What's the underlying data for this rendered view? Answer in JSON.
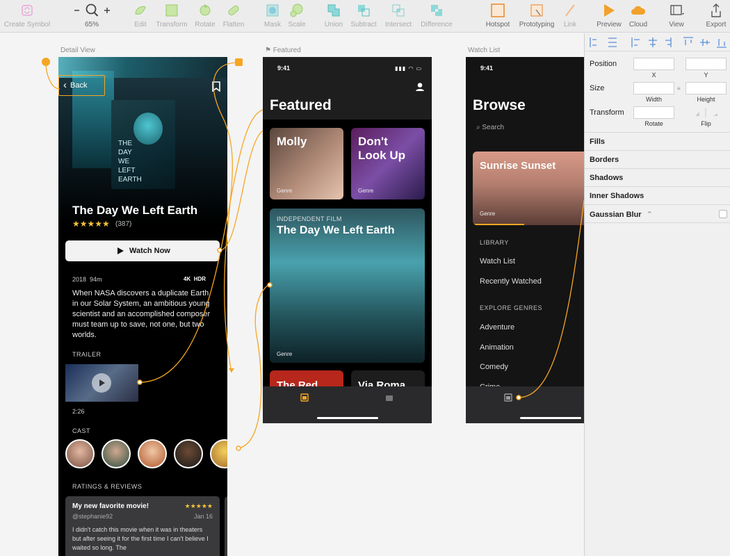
{
  "toolbar": {
    "create_symbol": "Create Symbol",
    "zoom": "65%",
    "edit": "Edit",
    "transform": "Transform",
    "rotate": "Rotate",
    "flatten": "Flatten",
    "mask": "Mask",
    "scale": "Scale",
    "union": "Union",
    "subtract": "Subtract",
    "intersect": "Intersect",
    "difference": "Difference",
    "hotspot": "Hotspot",
    "prototyping": "Prototyping",
    "link": "Link",
    "preview": "Preview",
    "cloud": "Cloud",
    "view": "View",
    "export": "Export"
  },
  "artboards": {
    "detail_label": "Detail View",
    "featured_label": "Featured",
    "watchlist_label": "Watch List"
  },
  "detail": {
    "back": "Back",
    "poster_text": "THE DAY WE LEFT EARTH",
    "title": "The Day We Left Earth",
    "stars": "★★★★★",
    "rating_count": "(387)",
    "watch_now": "Watch Now",
    "year": "2018",
    "runtime": "94m",
    "badge_4k": "4K",
    "badge_hdr": "HDR",
    "description": "When NASA discovers a duplicate Earth in our Solar System, an ambitious young scientist and an accomplished composer must team up to save, not one, but two worlds.",
    "trailer_header": "TRAILER",
    "trailer_duration": "2:26",
    "cast_header": "CAST",
    "ratings_header": "RATINGS & REVIEWS",
    "review": {
      "title": "My new favorite movie!",
      "stars": "★★★★★",
      "user": "@stephanie92",
      "date": "Jan 16",
      "body": "I didn't catch this movie when it was in theaters but after seeing it for the first time I can't believe I waited so long. The"
    }
  },
  "featured": {
    "time": "9:41",
    "title": "Featured",
    "tiles": [
      {
        "title": "Molly",
        "genre": "Genre"
      },
      {
        "title": "Don't Look Up",
        "genre": "Genre"
      },
      {
        "kicker": "INDEPENDENT FILM",
        "title": "The Day We Left Earth",
        "genre": "Genre"
      },
      {
        "title": "The Red"
      },
      {
        "title": "Via Roma"
      }
    ]
  },
  "watchlist": {
    "time": "9:41",
    "title": "Browse",
    "search_placeholder": "Search",
    "hero_title": "Sunrise Sunset",
    "hero_genre": "Genre",
    "library_header": "LIBRARY",
    "library_items": [
      "Watch List",
      "Recently Watched"
    ],
    "explore_header": "EXPLORE GENRES",
    "genres": [
      "Adventure",
      "Animation",
      "Comedy",
      "Crime"
    ]
  },
  "inspector": {
    "position": "Position",
    "x": "X",
    "y": "Y",
    "size": "Size",
    "width": "Width",
    "height": "Height",
    "transform": "Transform",
    "rotate": "Rotate",
    "flip": "Flip",
    "sections": [
      "Fills",
      "Borders",
      "Shadows",
      "Inner Shadows",
      "Gaussian Blur"
    ]
  },
  "colors": {
    "accent": "#f5a623",
    "canvas": "#f4f4f4",
    "artboard": "#000000"
  }
}
